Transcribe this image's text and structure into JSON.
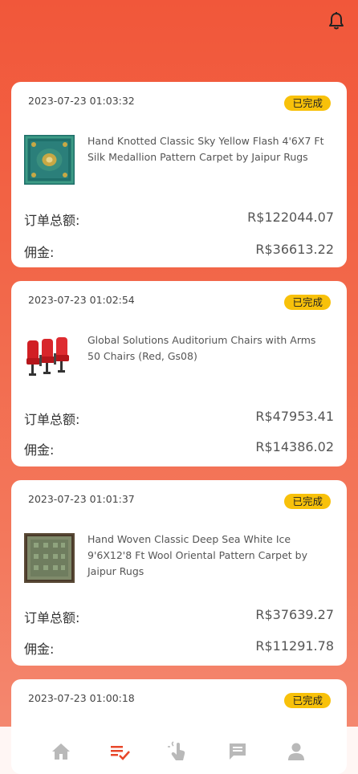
{
  "orders": [
    {
      "date": "2023-07-23 01:03:32",
      "status": "已完成",
      "title": "Hand Knotted Classic Sky Yellow Flash 4'6X7 Ft Silk Medallion Pattern Carpet by Jaipur Rugs",
      "total_label": "订单总额:",
      "total": "R$122044.07",
      "commission_label": "佣金:",
      "commission": "R$36613.22",
      "thumb": "carpet-blue"
    },
    {
      "date": "2023-07-23 01:02:54",
      "status": "已完成",
      "title": "Global Solutions Auditorium Chairs with Arms 50 Chairs (Red, Gs08)",
      "total_label": "订单总额:",
      "total": "R$47953.41",
      "commission_label": "佣金:",
      "commission": "R$14386.02",
      "thumb": "red-chairs"
    },
    {
      "date": "2023-07-23 01:01:37",
      "status": "已完成",
      "title": "Hand Woven Classic Deep Sea White Ice 9'6X12'8 Ft Wool Oriental Pattern Carpet by Jaipur Rugs",
      "total_label": "订单总额:",
      "total": "R$37639.27",
      "commission_label": "佣金:",
      "commission": "R$11291.78",
      "thumb": "carpet-green"
    },
    {
      "date": "2023-07-23 01:00:18",
      "status": "已完成"
    }
  ],
  "tabbar": {
    "items": [
      "home-icon",
      "orders-icon",
      "tap-icon",
      "message-icon",
      "profile-icon"
    ],
    "active_color": "#e8472a",
    "inactive_color": "#b9b9b9"
  },
  "colors": {
    "accent": "#f1573a",
    "badge": "#f8c10a"
  }
}
